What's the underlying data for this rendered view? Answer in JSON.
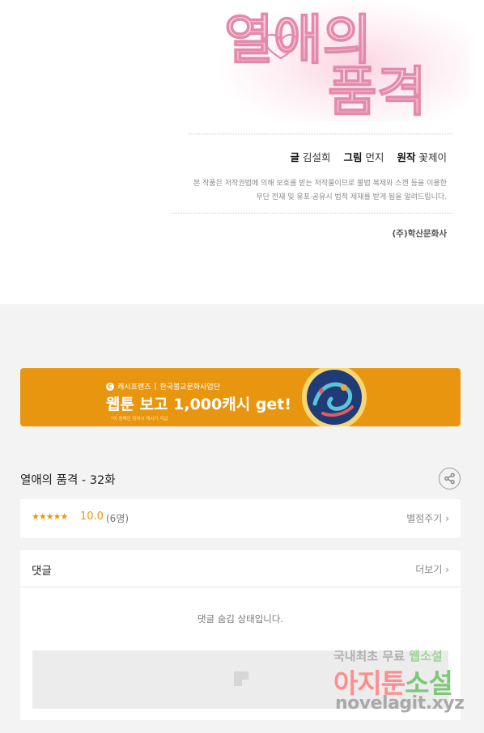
{
  "credit_page": {
    "title_art": {
      "line1": "열애의",
      "line2": "품격"
    },
    "credits": {
      "writer_label": "글",
      "writer": "김설희",
      "illustrator_label": "그림",
      "illustrator": "먼지",
      "original_label": "원작",
      "original": "꽃제이"
    },
    "notice_line1": "본 작품은 저작권법에 의해 보호를 받는 저작물이므로 불법 복제와 스캔 등을 이용한",
    "notice_line2": "무단 전재 및 유포·공유시 법적 제재를 받게 됨을 알려드립니다.",
    "publisher": "(주)학산문화사"
  },
  "banner": {
    "brand": "캐시프렌즈",
    "separator": "|",
    "partner": "한국불교문화사업단",
    "headline": "웹툰 보고 1,000캐시 get!",
    "fine_print": "*이 캠페인 참여시 캐시가 지급"
  },
  "episode": {
    "title": "열애의 품격 - 32화"
  },
  "rating": {
    "stars": "★★★★★",
    "score": "10.0",
    "count": "(6명)",
    "rate_label": "별점주기",
    "chevron": "›"
  },
  "comments": {
    "title": "댓글",
    "more_label": "더보기",
    "chevron": "›",
    "hidden_message": "댓글 숨김 상태입니다."
  },
  "watermark": {
    "line1_a": "국내최초 무료",
    "line1_b": "웹소설",
    "line2_a": "아지툰",
    "line2_b": "소설",
    "line3": "novelagit.xyz"
  },
  "colors": {
    "banner_bg": "#e8960f",
    "star": "#e8960f",
    "page_bg": "#f3f3f3",
    "title_pink": "#f2b8cc"
  },
  "icons": {
    "share": "share-icon",
    "banner_logo": "cash-friends-logo-icon",
    "placeholder": "image-placeholder-icon"
  }
}
